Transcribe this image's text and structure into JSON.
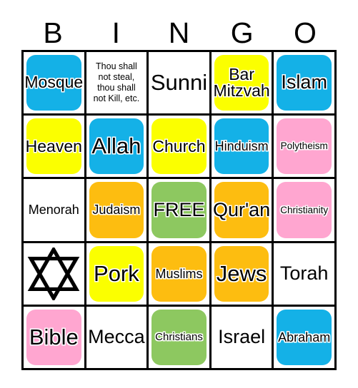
{
  "card": {
    "header_letters": [
      "B",
      "I",
      "N",
      "G",
      "O"
    ],
    "colors": {
      "blue": "#14B1E7",
      "yellow": "#FBFF00",
      "pink": "#FFA6D0",
      "orange": "#FDBD10",
      "green": "#8DC860",
      "white": "#FFFFFF",
      "border": "#000000",
      "text": "#000000"
    },
    "rows": [
      [
        {
          "label": "Mosque",
          "color": "blue",
          "size": "fs-md",
          "type": "text"
        },
        {
          "label": "Thou shall\nnot steal,\nthou shall\nnot Kill, etc.",
          "color": "white",
          "size": "fs-tiny",
          "type": "text"
        },
        {
          "label": "Sunni",
          "color": "white",
          "size": "fs-xl",
          "type": "text"
        },
        {
          "label": "Bar\nMitzvah",
          "color": "yellow",
          "size": "fs-md",
          "type": "text"
        },
        {
          "label": "Islam",
          "color": "blue",
          "size": "fs-lg",
          "type": "text"
        }
      ],
      [
        {
          "label": "Heaven",
          "color": "yellow",
          "size": "fs-md",
          "type": "text"
        },
        {
          "label": "Allah",
          "color": "blue",
          "size": "fs-xl",
          "type": "text"
        },
        {
          "label": "Church",
          "color": "yellow",
          "size": "fs-md",
          "type": "text"
        },
        {
          "label": "Hinduism",
          "color": "blue",
          "size": "fs-sm",
          "type": "text"
        },
        {
          "label": "Polytheism",
          "color": "pink",
          "size": "fs-xxs",
          "type": "text"
        }
      ],
      [
        {
          "label": "Menorah",
          "color": "white",
          "size": "fs-sm",
          "type": "text"
        },
        {
          "label": "Judaism",
          "color": "orange",
          "size": "fs-sm",
          "type": "text"
        },
        {
          "label": "FREE",
          "color": "green",
          "size": "fs-lg",
          "type": "text"
        },
        {
          "label": "Qur'an",
          "color": "orange",
          "size": "fs-lg",
          "type": "text"
        },
        {
          "label": "Christianity",
          "color": "pink",
          "size": "fs-xxs",
          "type": "text"
        }
      ],
      [
        {
          "label": "star-of-david",
          "color": "white",
          "size": "fs-md",
          "type": "star"
        },
        {
          "label": "Pork",
          "color": "yellow",
          "size": "fs-xl",
          "type": "text"
        },
        {
          "label": "Muslims",
          "color": "orange",
          "size": "fs-sm",
          "type": "text"
        },
        {
          "label": "Jews",
          "color": "orange",
          "size": "fs-xl",
          "type": "text"
        },
        {
          "label": "Torah",
          "color": "white",
          "size": "fs-lg",
          "type": "text"
        }
      ],
      [
        {
          "label": "Bible",
          "color": "pink",
          "size": "fs-xl",
          "type": "text"
        },
        {
          "label": "Mecca",
          "color": "white",
          "size": "fs-lg",
          "type": "text"
        },
        {
          "label": "Christians",
          "color": "green",
          "size": "fs-xs",
          "type": "text"
        },
        {
          "label": "Israel",
          "color": "white",
          "size": "fs-lg",
          "type": "text"
        },
        {
          "label": "Abraham",
          "color": "blue",
          "size": "fs-sm",
          "type": "text"
        }
      ]
    ]
  }
}
